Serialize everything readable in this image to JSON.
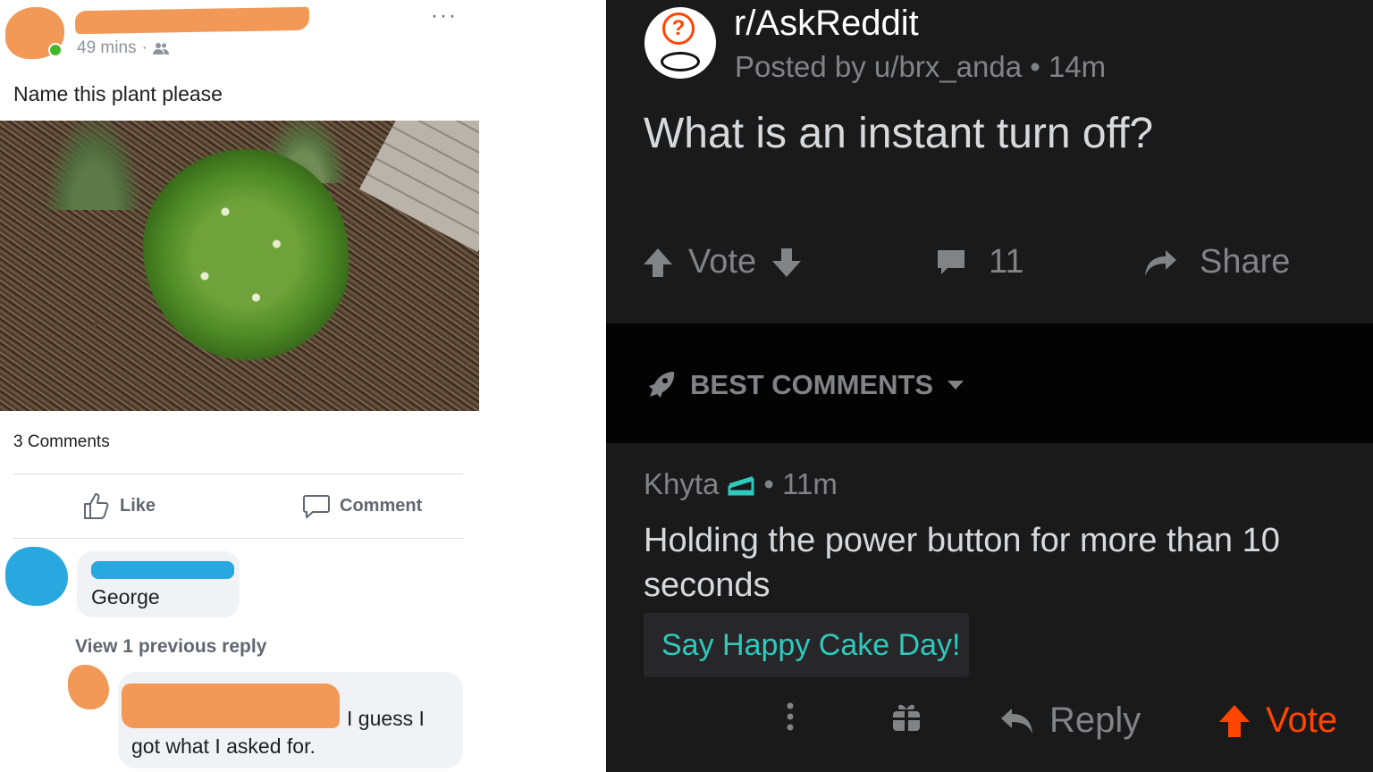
{
  "facebook_post": {
    "timestamp": "49 mins",
    "audience_icon": "friends-icon",
    "more_icon": "ellipsis-icon",
    "more_glyph": "···",
    "caption": "Name this plant please",
    "comments_count": "3 Comments",
    "like_label": "Like",
    "comment_label": "Comment",
    "comments": [
      {
        "text": "George"
      },
      {
        "view_previous": "View 1 previous reply",
        "text_line1": "I guess I",
        "text_line2": "got what I asked for."
      }
    ]
  },
  "reddit_post": {
    "subreddit": "r/AskReddit",
    "posted_by": "Posted by u/brx_anda • 14m",
    "title": "What is an instant turn off?",
    "vote_label": "Vote",
    "comment_count": "11",
    "share_label": "Share",
    "sort_label": "BEST COMMENTS",
    "comment": {
      "author": "Khyta",
      "age": "• 11m",
      "body": "Holding the power button for more than 10 seconds",
      "cake_button": "Say Happy Cake Day!",
      "reply_label": "Reply",
      "vote_label": "Vote"
    },
    "accent_color": "#ff4500",
    "cake_color": "#2fc9bd"
  }
}
